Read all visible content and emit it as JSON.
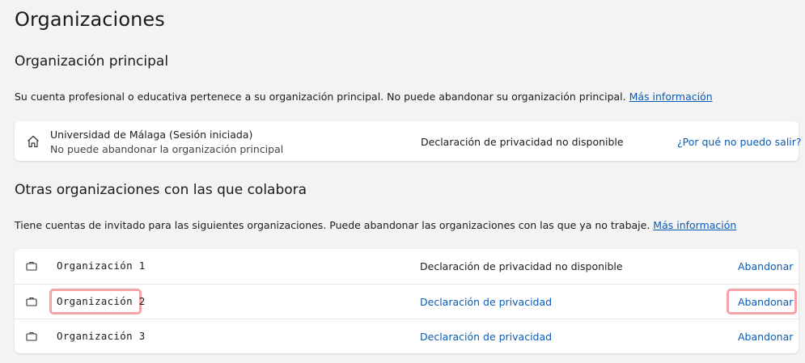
{
  "page": {
    "title": "Organizaciones"
  },
  "primary": {
    "section_title": "Organización principal",
    "description": "Su cuenta profesional o educativa pertenece a su organización principal. No puede abandonar su organización principal.",
    "more_info_link": "Más información",
    "org": {
      "icon": "home-icon",
      "name": "Universidad de Málaga (Sesión iniciada)",
      "subtitle": "No puede abandonar la organización principal",
      "privacy": "Declaración de privacidad no disponible",
      "action": "¿Por qué no puedo salir?"
    }
  },
  "others": {
    "section_title": "Otras organizaciones con las que colabora",
    "description": "Tiene cuentas de invitado para las siguientes organizaciones. Puede abandonar las organizaciones con las que ya no trabaje.",
    "more_info_link": "Más información",
    "orgs": [
      {
        "icon": "briefcase-icon",
        "name": "Organización 1",
        "privacy": "Declaración de privacidad no disponible",
        "privacy_is_link": false,
        "action": "Abandonar"
      },
      {
        "icon": "briefcase-icon",
        "name": "Organización 2",
        "privacy": "Declaración de privacidad",
        "privacy_is_link": true,
        "action": "Abandonar",
        "highlighted": true
      },
      {
        "icon": "briefcase-icon",
        "name": "Organización 3",
        "privacy": "Declaración de privacidad",
        "privacy_is_link": true,
        "action": "Abandonar"
      }
    ]
  },
  "colors": {
    "background": "#f3f3f3",
    "card": "#ffffff",
    "link": "#0b5bb5",
    "highlight": "#f4a3a8"
  }
}
